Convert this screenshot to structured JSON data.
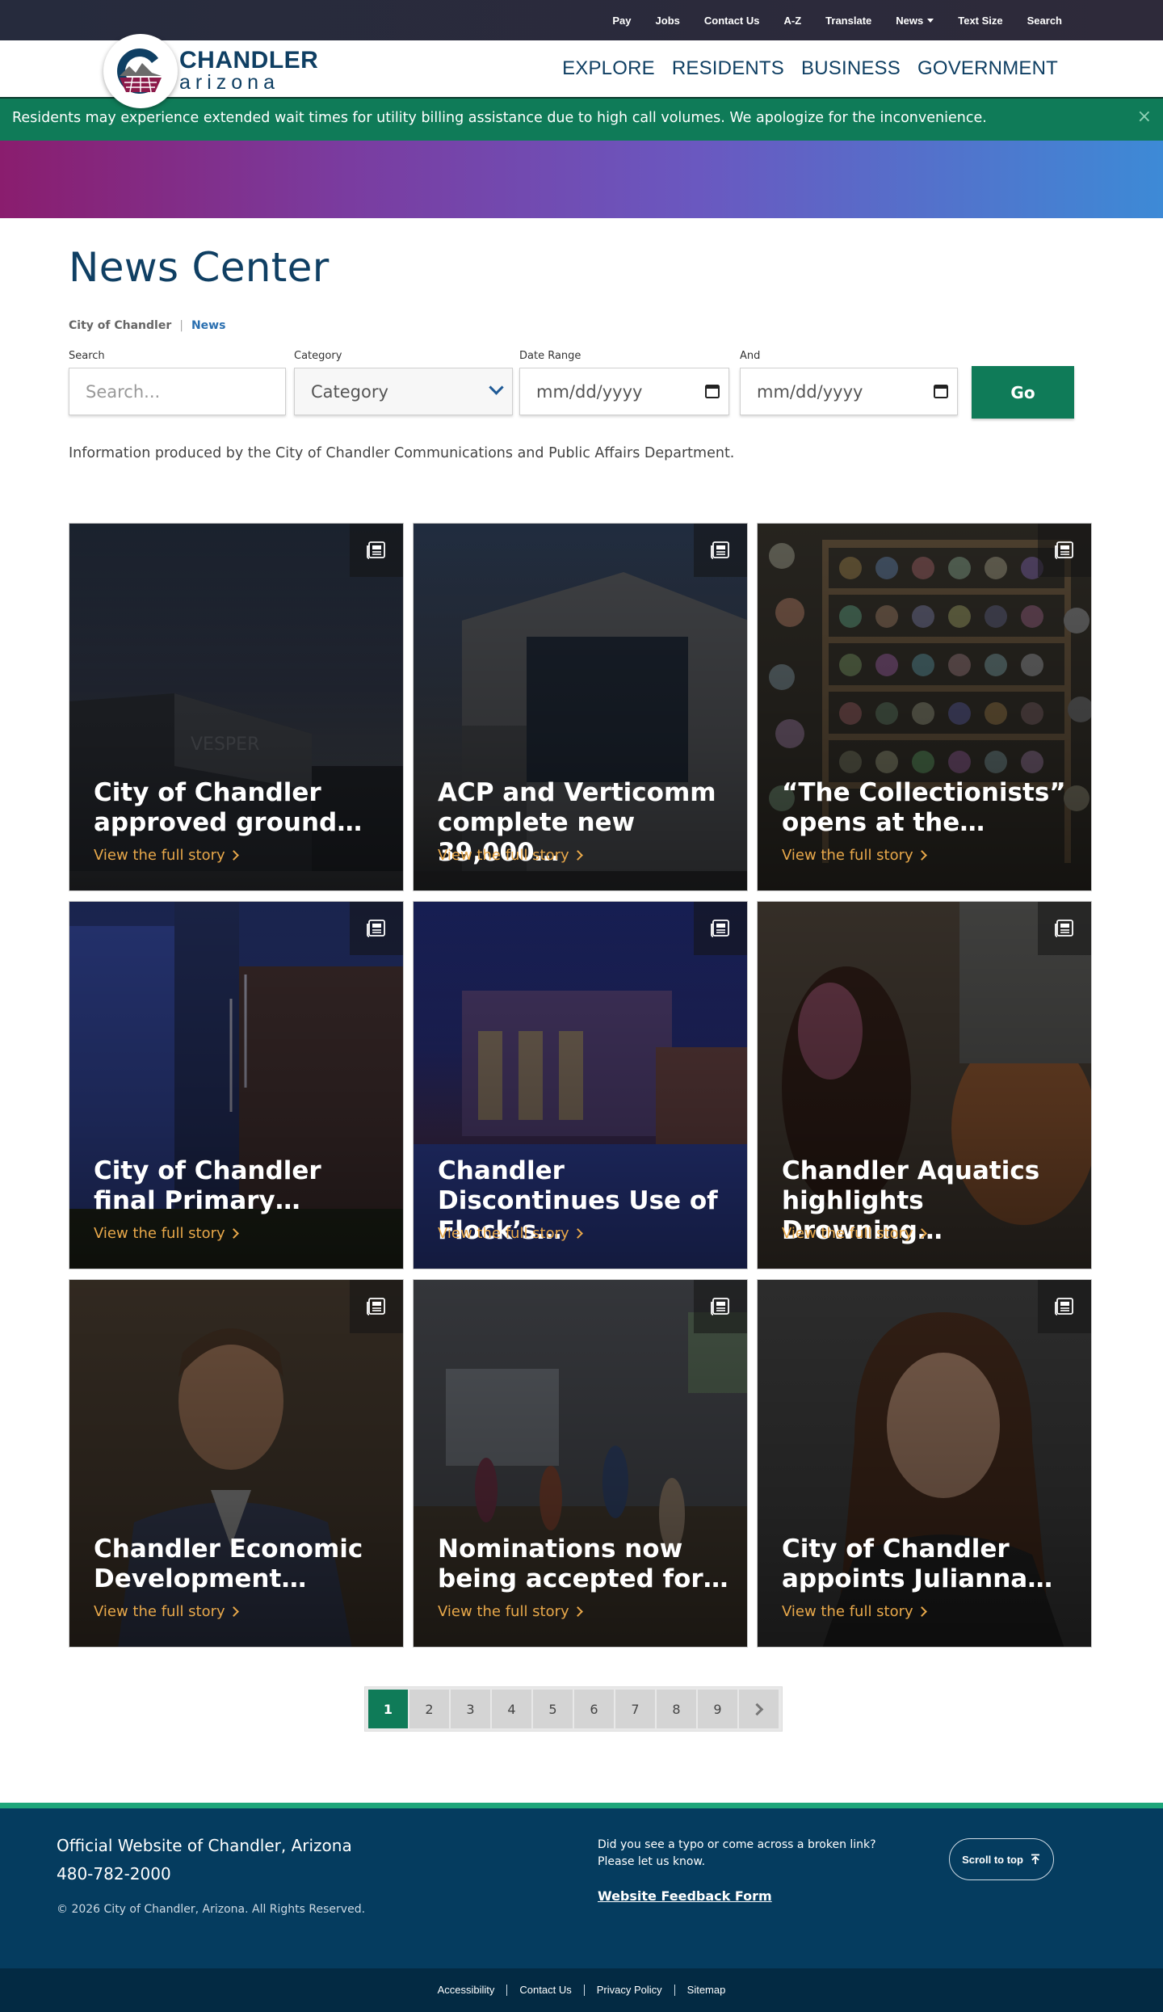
{
  "utility_nav": {
    "items": [
      "Pay",
      "Jobs",
      "Contact Us",
      "A-Z",
      "Translate",
      "News",
      "Text Size",
      "Search"
    ]
  },
  "logo": {
    "line1": "CHANDLER",
    "line2": "arizona"
  },
  "main_nav": {
    "items": [
      "EXPLORE",
      "RESIDENTS",
      "BUSINESS",
      "GOVERNMENT"
    ]
  },
  "alert": {
    "text": "Residents may experience extended wait times for utility billing assistance due to high call volumes. We apologize for the inconvenience.",
    "close": "×"
  },
  "page": {
    "title": "News Center"
  },
  "breadcrumb": {
    "items": [
      "City of Chandler",
      "News"
    ],
    "separator": "|"
  },
  "filters": {
    "search_label": "Search",
    "search_placeholder": "Search...",
    "category_label": "Category",
    "category_value": "Category",
    "date_label": "Date Range",
    "date_placeholder": "mm/dd/yyyy",
    "and_label": "And",
    "and_placeholder": "mm/dd/yyyy",
    "go_label": "Go"
  },
  "info_text": "Information produced by the City of Chandler Communications and Public Affairs Department.",
  "cards": [
    {
      "title": "City of Chandler approved ground…",
      "link": "View the full story",
      "icon": "newspaper-icon"
    },
    {
      "title": "ACP and Verticomm complete new 39,000…",
      "link": "View the full story",
      "icon": "newspaper-icon"
    },
    {
      "title": "“The Collectionists” opens at the…",
      "link": "View the full story",
      "icon": "newspaper-icon"
    },
    {
      "title": "City of Chandler final Primary…",
      "link": "View the full story",
      "icon": "newspaper-icon"
    },
    {
      "title": "Chandler Discontinues Use of Flock’s…",
      "link": "View the full story",
      "icon": "newspaper-icon"
    },
    {
      "title": "Chandler Aquatics highlights Drowning…",
      "link": "View the full story",
      "icon": "newspaper-icon"
    },
    {
      "title": "Chandler Economic Development…",
      "link": "View the full story",
      "icon": "newspaper-icon"
    },
    {
      "title": "Nominations now being accepted for…",
      "link": "View the full story",
      "icon": "newspaper-icon"
    },
    {
      "title": "City of Chandler appoints Julianna…",
      "link": "View the full story",
      "icon": "newspaper-icon"
    }
  ],
  "pagination": {
    "pages": [
      "1",
      "2",
      "3",
      "4",
      "5",
      "6",
      "7",
      "8",
      "9"
    ],
    "current": "1"
  },
  "footer": {
    "title": "Official Website of Chandler, Arizona",
    "phone": "480-782-2000",
    "copyright": "© 2026 City of Chandler, Arizona. All Rights Reserved.",
    "typo_text": "Did you see a typo or come across a broken link? Please let us know.",
    "feedback_link": "Website Feedback Form",
    "scroll_top": "Scroll to top"
  },
  "subfooter": {
    "links": [
      "Accessibility",
      "Contact Us",
      "Privacy Policy",
      "Sitemap"
    ]
  },
  "colors": {
    "brand_green": "#0f7b58",
    "brand_navy": "#0f3f63",
    "footer_bg": "#053c5f",
    "link_orange": "#e8a84a"
  }
}
